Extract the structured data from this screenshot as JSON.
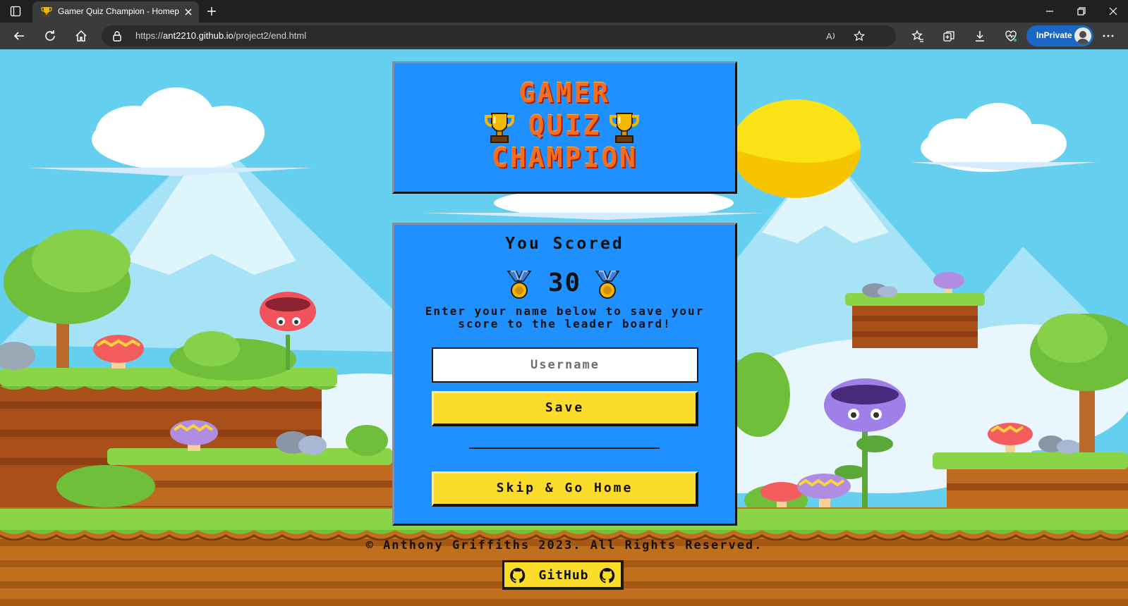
{
  "browser": {
    "tab_title": "Gamer Quiz Champion - Homep",
    "url_prefix": "https://",
    "url_host": "ant2210.github.io",
    "url_path": "/project2/end.html",
    "inprivate_label": "InPrivate"
  },
  "header": {
    "line1": "GAMER",
    "line2": "QUIZ",
    "line3": "CHAMPION"
  },
  "result": {
    "heading": "You Scored",
    "score": "30",
    "instructions": "Enter your name below to save your score to the leader board!",
    "username_placeholder": "Username",
    "save_label": "Save",
    "home_label": "Skip & Go Home"
  },
  "footer": {
    "copyright": "© Anthony Griffiths 2023. All Rights Reserved.",
    "github_label": "GitHub"
  },
  "colors": {
    "panel_blue": "#1e90ff",
    "button_yellow": "#fbdc2b",
    "logo_orange": "#f36f1f",
    "sky": "#64cfee"
  },
  "icons": [
    "trophy-icon",
    "medal-icon",
    "github-icon",
    "lock-icon",
    "back-icon",
    "refresh-icon",
    "home-icon"
  ]
}
